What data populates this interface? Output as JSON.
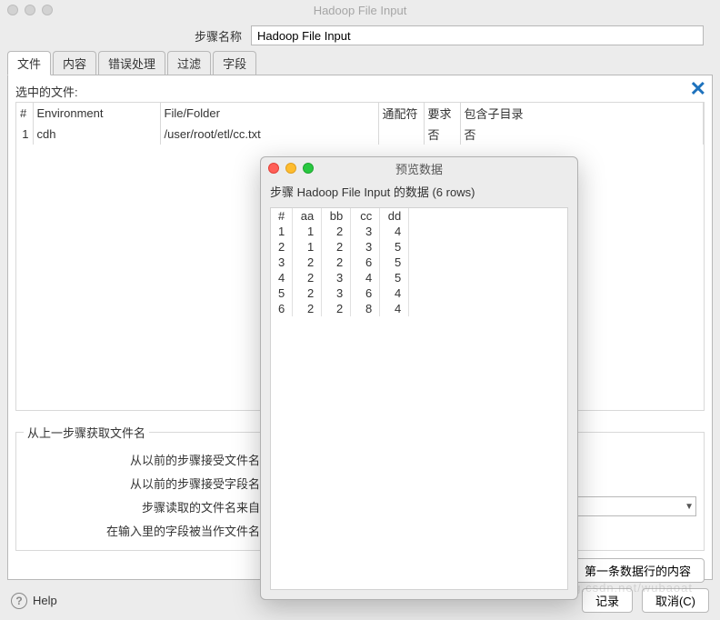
{
  "window": {
    "title": "Hadoop File Input"
  },
  "step_name": {
    "label": "步骤名称",
    "value": "Hadoop File Input"
  },
  "tabs": [
    "文件",
    "内容",
    "错误处理",
    "过滤",
    "字段"
  ],
  "active_tab": "文件",
  "selected_file_label": "选中的文件:",
  "file_table": {
    "headers": {
      "num": "#",
      "env": "Environment",
      "file": "File/Folder",
      "wildcard": "通配符",
      "required": "要求",
      "subdirs": "包含子目录"
    },
    "rows": [
      {
        "num": "1",
        "env": "cdh",
        "file": "/user/root/etl/cc.txt",
        "wildcard": "",
        "required": "否",
        "subdirs": "否"
      }
    ]
  },
  "prev_step": {
    "legend": "从上一步骤获取文件名",
    "accept_filename": "从以前的步骤接受文件名",
    "accept_fieldname": "从以前的步骤接受字段名",
    "step_source": "步骤读取的文件名来自",
    "field_in_input": "在输入里的字段被当作文件名"
  },
  "buttons": {
    "first_row": "第一条数据行的内容",
    "records": "记录",
    "cancel": "取消(C)",
    "help": "Help"
  },
  "dialog": {
    "title": "预览数据",
    "subtitle": "步骤 Hadoop File Input 的数据  (6 rows)",
    "headers": [
      "#",
      "aa",
      "bb",
      "cc",
      "dd"
    ],
    "rows": [
      [
        "1",
        "1",
        "2",
        "3",
        "4"
      ],
      [
        "2",
        "1",
        "2",
        "3",
        "5"
      ],
      [
        "3",
        "2",
        "2",
        "6",
        "5"
      ],
      [
        "4",
        "2",
        "3",
        "4",
        "5"
      ],
      [
        "5",
        "2",
        "3",
        "6",
        "4"
      ],
      [
        "6",
        "2",
        "2",
        "8",
        "4"
      ]
    ]
  },
  "watermark": "https://blog.csdn.net/wubaoat"
}
